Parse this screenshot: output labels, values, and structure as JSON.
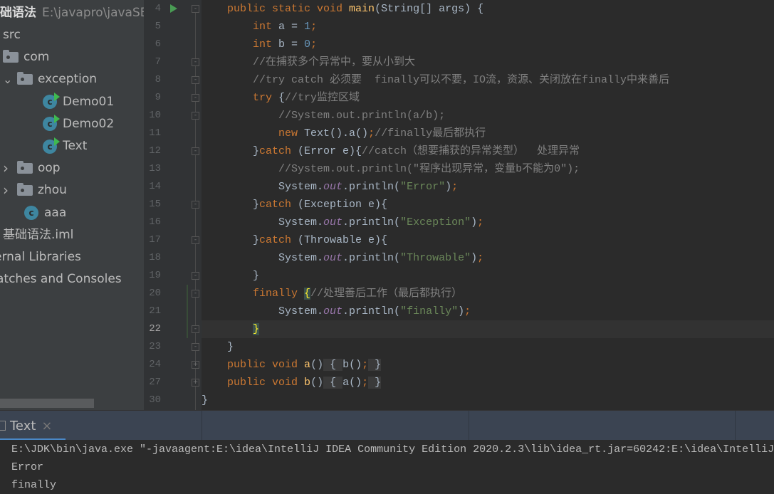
{
  "project": {
    "name": "础语法",
    "path": "E:\\javapro\\javaSE"
  },
  "tree": [
    {
      "label": "src",
      "type": "plain",
      "indent": 0
    },
    {
      "label": "com",
      "type": "folder",
      "indent": 0
    },
    {
      "label": "exception",
      "type": "folder",
      "indent": 1,
      "expanded": true
    },
    {
      "label": "Demo01",
      "type": "class-run",
      "indent": 2
    },
    {
      "label": "Demo02",
      "type": "class-run",
      "indent": 2
    },
    {
      "label": "Text",
      "type": "class-run",
      "indent": 2
    },
    {
      "label": "oop",
      "type": "folder",
      "indent": 1,
      "collapsed": true
    },
    {
      "label": "zhou",
      "type": "folder",
      "indent": 1,
      "collapsed": true
    },
    {
      "label": "aaa",
      "type": "class",
      "indent": 1
    },
    {
      "label": "基础语法.iml",
      "type": "plain",
      "indent": 0
    },
    {
      "label": "ernal Libraries",
      "type": "plain",
      "indent": 0
    },
    {
      "label": "ratches and Consoles",
      "type": "plain",
      "indent": 0
    }
  ],
  "editor": {
    "current_line": "22",
    "lines": [
      {
        "n": "4",
        "fold": "-",
        "t": [
          [
            "    "
          ],
          [
            "public static void ",
            "kw"
          ],
          [
            "main",
            "fn"
          ],
          [
            "(String[] args) {"
          ]
        ]
      },
      {
        "n": "5",
        "t": [
          [
            "        "
          ],
          [
            "int ",
            "kw"
          ],
          [
            "a = "
          ],
          [
            "1",
            "num"
          ],
          [
            ";",
            "kw"
          ]
        ]
      },
      {
        "n": "6",
        "t": [
          [
            "        "
          ],
          [
            "int ",
            "kw"
          ],
          [
            "b = "
          ],
          [
            "0",
            "num"
          ],
          [
            ";",
            "kw"
          ]
        ]
      },
      {
        "n": "7",
        "fold": "-",
        "t": [
          [
            "        "
          ],
          [
            "//在捕获多个异常中，要从小到大",
            "cm"
          ]
        ]
      },
      {
        "n": "8",
        "fold": "-",
        "t": [
          [
            "        "
          ],
          [
            "//try catch 必须要  finally可以不要，IO流，资源、关闭放在finally中来善后",
            "cm"
          ]
        ]
      },
      {
        "n": "9",
        "fold": "-",
        "t": [
          [
            "        "
          ],
          [
            "try ",
            "kw"
          ],
          [
            "{"
          ],
          [
            "//try监控区域",
            "cm"
          ]
        ]
      },
      {
        "n": "10",
        "fold": "-",
        "t": [
          [
            "            "
          ],
          [
            "//System.out.println(a/b);",
            "cm"
          ]
        ]
      },
      {
        "n": "11",
        "t": [
          [
            "            "
          ],
          [
            "new ",
            "kw"
          ],
          [
            "Text().a()"
          ],
          [
            ";",
            "kw"
          ],
          [
            "//finally最后都执行",
            "cm"
          ]
        ]
      },
      {
        "n": "12",
        "fold": "-",
        "t": [
          [
            "        }"
          ],
          [
            "catch ",
            "kw"
          ],
          [
            "(Error e){"
          ],
          [
            "//catch（想要捕获的异常类型）  处理异常",
            "cm"
          ]
        ]
      },
      {
        "n": "13",
        "t": [
          [
            "            "
          ],
          [
            "//System.out.println(\"程序出现异常，变量b不能为0\");",
            "cm"
          ]
        ]
      },
      {
        "n": "14",
        "t": [
          [
            "            System."
          ],
          [
            "out",
            "st"
          ],
          [
            ".println("
          ],
          [
            "\"Error\"",
            "str"
          ],
          [
            ")"
          ],
          [
            ";",
            "kw"
          ]
        ]
      },
      {
        "n": "15",
        "fold": "-",
        "t": [
          [
            "        }"
          ],
          [
            "catch ",
            "kw"
          ],
          [
            "(Exception e){"
          ]
        ]
      },
      {
        "n": "16",
        "t": [
          [
            "            System."
          ],
          [
            "out",
            "st"
          ],
          [
            ".println("
          ],
          [
            "\"Exception\"",
            "str"
          ],
          [
            ")"
          ],
          [
            ";",
            "kw"
          ]
        ]
      },
      {
        "n": "17",
        "fold": "-",
        "t": [
          [
            "        }"
          ],
          [
            "catch ",
            "kw"
          ],
          [
            "(Throwable e){"
          ]
        ]
      },
      {
        "n": "18",
        "t": [
          [
            "            System."
          ],
          [
            "out",
            "st"
          ],
          [
            ".println("
          ],
          [
            "\"Throwable\"",
            "str"
          ],
          [
            ")"
          ],
          [
            ";",
            "kw"
          ]
        ]
      },
      {
        "n": "19",
        "fold": "-",
        "t": [
          [
            "        }"
          ]
        ]
      },
      {
        "n": "20",
        "fold": "-",
        "t": [
          [
            "        "
          ],
          [
            "finally ",
            "kw"
          ],
          [
            "{",
            "brh"
          ],
          [
            "//处理善后工作（最后都执行）",
            "cm"
          ]
        ]
      },
      {
        "n": "21",
        "t": [
          [
            "            System."
          ],
          [
            "out",
            "st"
          ],
          [
            ".println("
          ],
          [
            "\"finally\"",
            "str"
          ],
          [
            ")"
          ],
          [
            ";",
            "kw"
          ]
        ]
      },
      {
        "n": "22",
        "fold": "-",
        "t": [
          [
            "        "
          ],
          [
            "}",
            "brh"
          ]
        ]
      },
      {
        "n": "23",
        "fold": "-",
        "t": [
          [
            "    }"
          ]
        ]
      },
      {
        "n": "24",
        "fold": "+",
        "t": [
          [
            "    "
          ],
          [
            "public void ",
            "kw"
          ],
          [
            "a",
            "fn"
          ],
          [
            "()"
          ],
          [
            " { ",
            "fb"
          ],
          [
            "b()"
          ],
          [
            ";",
            "kw"
          ],
          [
            " }",
            "fb"
          ]
        ]
      },
      {
        "n": "27",
        "fold": "+",
        "t": [
          [
            "    "
          ],
          [
            "public void ",
            "kw"
          ],
          [
            "b",
            "fn"
          ],
          [
            "()"
          ],
          [
            " { ",
            "fb"
          ],
          [
            "a()"
          ],
          [
            ";",
            "kw"
          ],
          [
            " }",
            "fb"
          ]
        ]
      },
      {
        "n": "30",
        "t": [
          [
            "}"
          ]
        ]
      }
    ]
  },
  "run_panel": {
    "tab_label": "Text",
    "close": "×"
  },
  "console": [
    "E:\\JDK\\bin\\java.exe \"-javaagent:E:\\idea\\IntelliJ IDEA Community Edition 2020.2.3\\lib\\idea_rt.jar=60242:E:\\idea\\IntelliJ",
    "Error",
    "finally"
  ]
}
